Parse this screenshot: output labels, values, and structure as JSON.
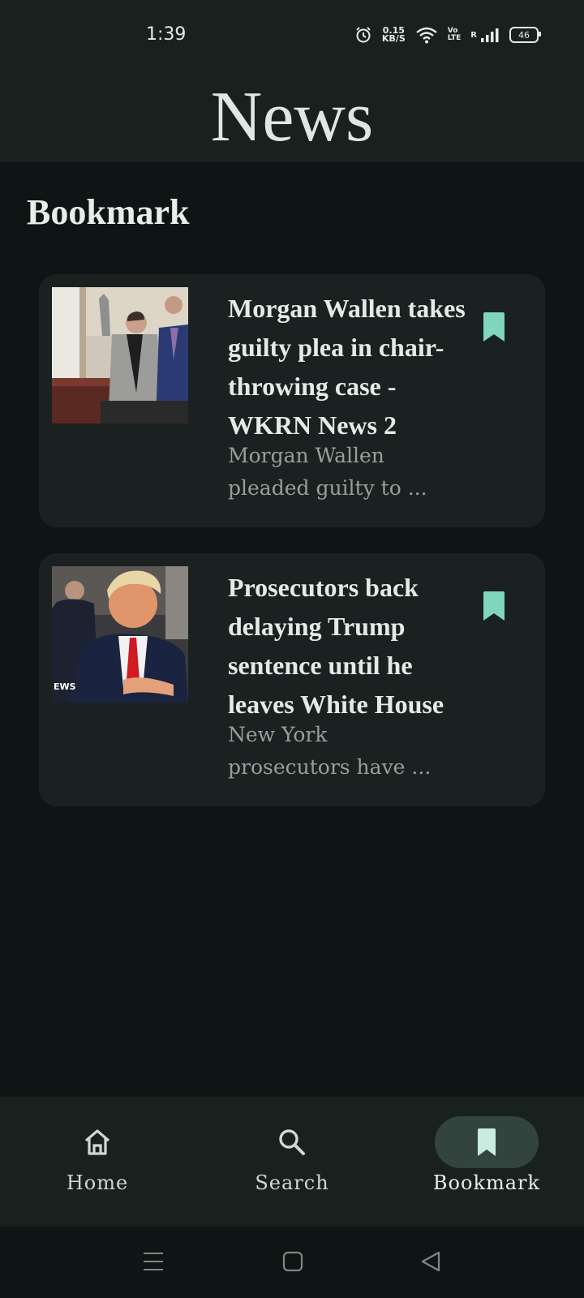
{
  "status_bar": {
    "time": "1:39",
    "net_speed_value": "0.15",
    "net_speed_unit": "KB/S",
    "volte_top": "Vo",
    "volte_bottom": "LTE",
    "roaming": "R",
    "battery": "46",
    "icons": [
      "alarm-icon",
      "wifi-icon",
      "signal-icon",
      "battery-icon"
    ]
  },
  "header": {
    "title": "News"
  },
  "page": {
    "heading": "Bookmark"
  },
  "articles": [
    {
      "title": "Morgan Wallen takes guilty plea in chair-throwing case - WKRN News 2",
      "description_line1": "Morgan Wallen",
      "description_line2": "pleaded guilty to ...",
      "bookmarked": true
    },
    {
      "title": "Prosecutors back delaying Trump sentence until he leaves White House",
      "description_line1": "New York",
      "description_line2": "prosecutors have ...",
      "image_caption": "EWS",
      "bookmarked": true
    }
  ],
  "bottom_nav": {
    "items": [
      {
        "label": "Home",
        "icon": "home-icon",
        "active": false
      },
      {
        "label": "Search",
        "icon": "search-icon",
        "active": false
      },
      {
        "label": "Bookmark",
        "icon": "bookmark-icon",
        "active": true
      }
    ]
  },
  "colors": {
    "background": "#0f1514",
    "surface": "#19211f",
    "card": "#1b2120",
    "accent": "#7fd6bb",
    "active_pill": "#33443f"
  }
}
